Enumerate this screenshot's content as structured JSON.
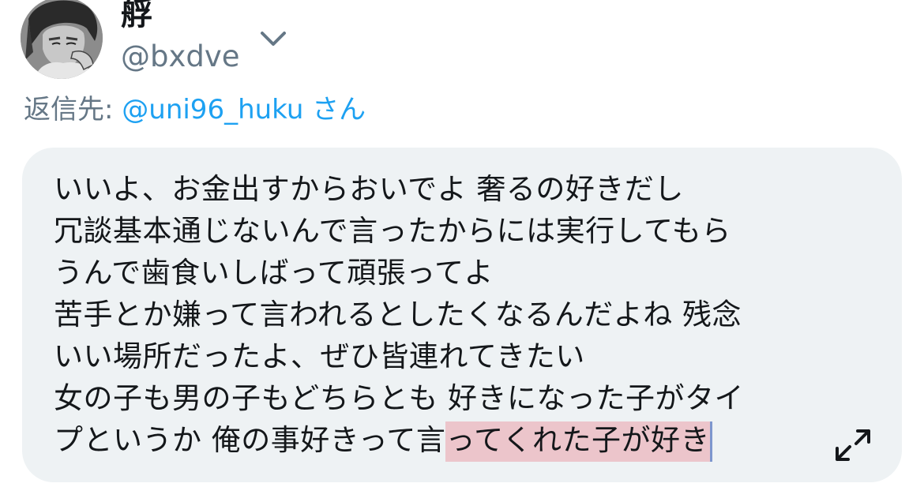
{
  "user": {
    "display_name": "艀",
    "handle": "@bxdve",
    "avatar_icon": "profile-photo"
  },
  "menu": {
    "chevron_icon": "chevron-down-icon"
  },
  "reply": {
    "prefix": "返信先: ",
    "mention": "@uni96_huku",
    "suffix": " さん"
  },
  "tweet": {
    "lines": [
      "いいよ、お金出すからおいでよ 奢るの好きだし",
      "冗談基本通じないんで言ったからには実行してもら",
      "うんで歯食いしばって頑張ってよ",
      "苦手とか嫌って言われるとしたくなるんだよね 残念",
      "いい場所だったよ、ぜひ皆連れてきたい",
      "女の子も男の子もどちらとも 好きになった子がタイ"
    ],
    "last_line_plain": "プというか 俺の事好きって言",
    "last_line_highlighted": "ってくれた子が好き"
  },
  "colors": {
    "text": "#14171a",
    "muted": "#657786",
    "link": "#1da1f2",
    "card_bg": "#eef2f4",
    "highlight": "#ecc5cb",
    "caret": "#7d96ce"
  },
  "expand": {
    "icon": "expand-icon"
  }
}
